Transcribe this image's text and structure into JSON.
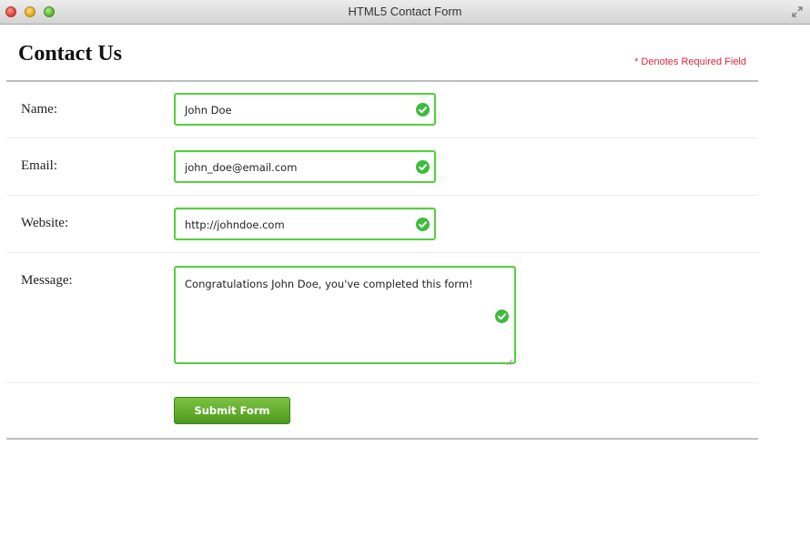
{
  "window": {
    "title": "HTML5 Contact Form"
  },
  "form": {
    "heading": "Contact Us",
    "required_note": "* Denotes Required Field",
    "fields": [
      {
        "label": "Name:",
        "value": "John Doe",
        "valid": true
      },
      {
        "label": "Email:",
        "value": "john_doe@email.com",
        "valid": true
      },
      {
        "label": "Website:",
        "value": "http://johndoe.com",
        "valid": true
      },
      {
        "label": "Message:",
        "value": "Congratulations John Doe, you've completed this form!",
        "valid": true
      }
    ],
    "submit_label": "Submit Form"
  },
  "colors": {
    "valid_border": "#55cf3e",
    "valid_icon": "#3dbb3d",
    "required_text": "#e3263a",
    "button_green": "#5aa82a"
  },
  "icons": [
    "close-button",
    "minimize-button",
    "zoom-button",
    "fullscreen-icon",
    "check-circle-icon",
    "resize-grip-icon"
  ]
}
